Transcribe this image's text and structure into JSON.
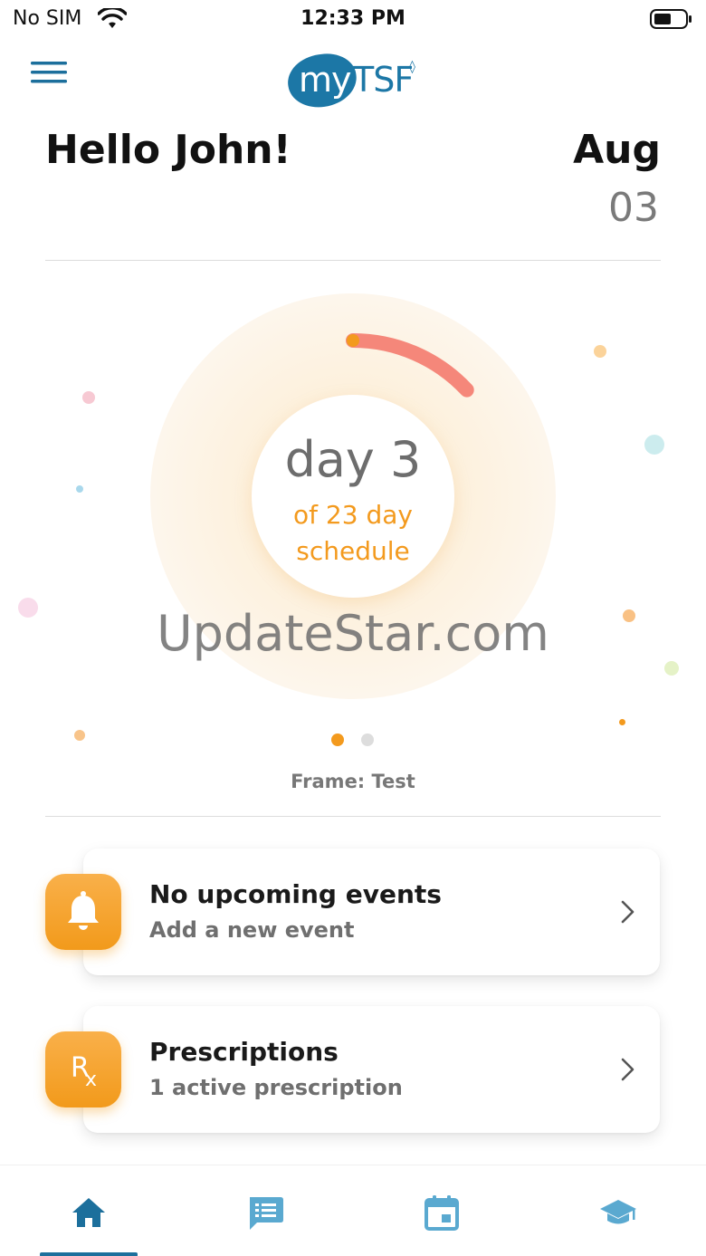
{
  "status_bar": {
    "carrier": "No SIM",
    "time": "12:33 PM"
  },
  "header": {
    "menu_icon": "hamburger-menu-icon",
    "logo": {
      "my": "my",
      "tsf": "TSF",
      "mark": "◊"
    }
  },
  "greeting": {
    "text": "Hello John!",
    "month": "Aug",
    "day": "03"
  },
  "progress": {
    "day_label": "day 3",
    "of_label": "of 23 day",
    "schedule_label": "schedule",
    "current_day": 3,
    "total_days": 23,
    "progress_color": "#f5877a",
    "start_dot_color": "#f39a1e"
  },
  "watermark": "UpdateStar.com",
  "pager": {
    "active_index": 0,
    "count": 2,
    "active_color": "#f39a1e",
    "inactive_color": "#dddddd"
  },
  "frame_label": "Frame: Test",
  "cards": [
    {
      "icon": "bell-icon",
      "title": "No upcoming events",
      "subtitle": "Add a new event"
    },
    {
      "icon": "rx-icon",
      "title": "Prescriptions",
      "subtitle": "1 active prescription"
    }
  ],
  "bottom_nav": {
    "items": [
      {
        "icon": "home-icon",
        "active": true
      },
      {
        "icon": "messages-icon",
        "active": false
      },
      {
        "icon": "calendar-icon",
        "active": false
      },
      {
        "icon": "education-icon",
        "active": false
      }
    ],
    "active_color": "#1c6f9c",
    "inactive_color": "#5aa9d0"
  },
  "colors": {
    "brand": "#1c77a6",
    "accent": "#f39a1e"
  }
}
